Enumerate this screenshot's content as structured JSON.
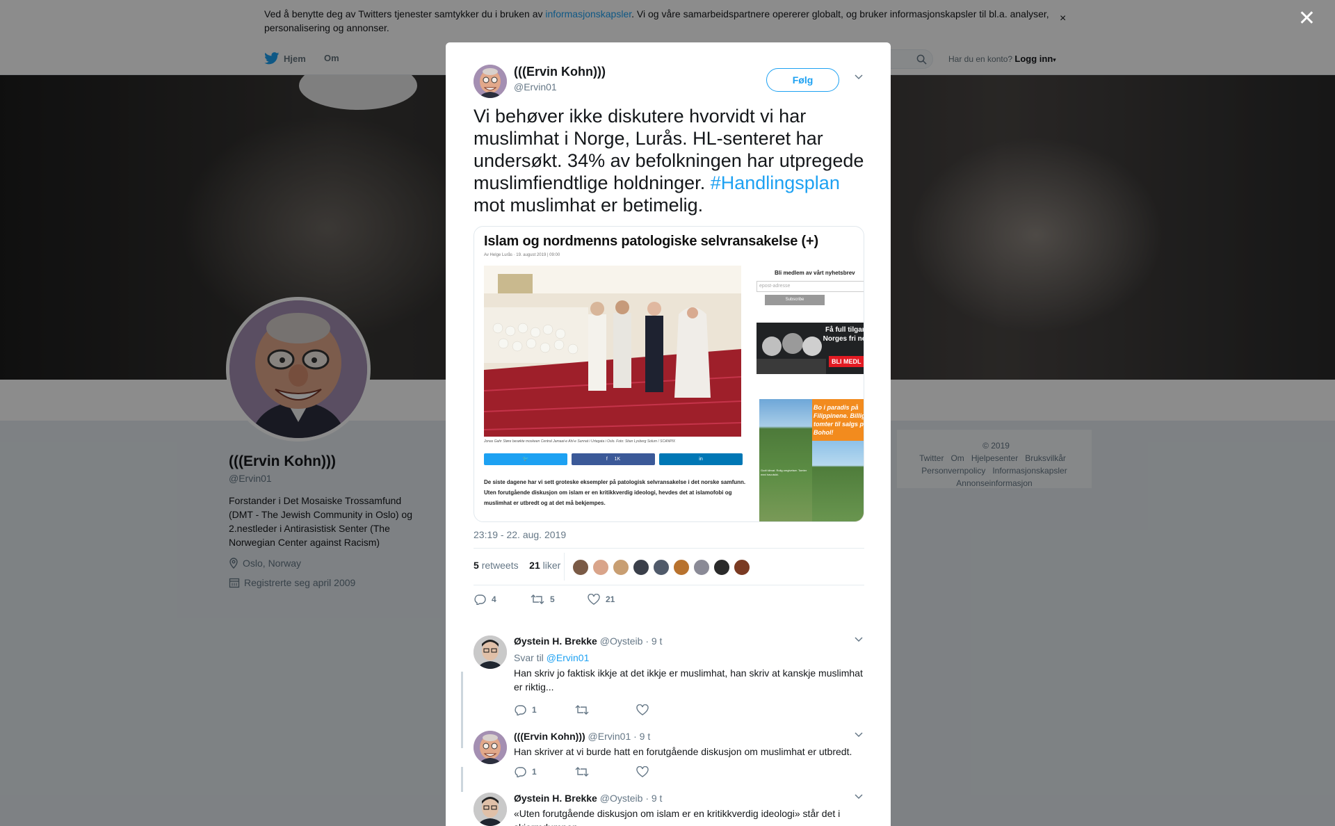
{
  "cookie": {
    "text_before": "Ved å benytte deg av Twitters tjenester samtykker du i bruken av ",
    "link": "informasjonskapsler",
    "text_after": ". Vi og våre samarbeidspartnere opererer globalt, og bruker informasjonskapsler til bl.a. analyser, personalisering og annonser.",
    "close": "×"
  },
  "nav": {
    "home": "Hjem",
    "about": "Om",
    "have_account": "Har du en konto?",
    "login": "Logg inn"
  },
  "profile": {
    "name": "(((Ervin Kohn)))",
    "handle": "@Ervin01",
    "bio": "Forstander i Det Mosaiske Trossamfund (DMT - The Jewish Community in Oslo) og 2.nestleder i Antirasistisk Senter (The Norwegian Center against Racism)",
    "location": "Oslo, Norway",
    "joined": "Registrerte seg april 2009"
  },
  "footer": {
    "row1": [
      "© 2019 Twitter",
      "Om",
      "Hjelpesenter",
      "Bruksvilkår"
    ],
    "row2": [
      "Personvernpolicy",
      "Informasjonskapsler"
    ],
    "row3": [
      "Annonseinformasjon"
    ]
  },
  "overlay_close": "✕",
  "tweet": {
    "name": "(((Ervin Kohn)))",
    "handle": "@Ervin01",
    "follow": "Følg",
    "text": "Vi behøver ikke diskutere hvorvidt vi har muslimhat i Norge, Lurås. HL-senteret har undersøkt. 34% av befolkningen har utpregede muslimfiendtlige holdninger. ",
    "hashtag": "#Handlingsplan",
    "text_end": " mot muslimhat er betimelig.",
    "time": "23:19 - 22. aug. 2019",
    "retweets": "5",
    "retweets_label": "retweets",
    "likes": "21",
    "likes_label": "liker",
    "reply_count": "4",
    "retweet_count": "5",
    "like_count": "21",
    "liker_colors": [
      "#7a5a46",
      "#d9a48a",
      "#c89e72",
      "#3a3f4a",
      "#505a6a",
      "#b8722e",
      "#8a8a96",
      "#2a2a2a",
      "#7a3a22"
    ]
  },
  "card": {
    "headline": "Islam og nordmenns patologiske selvransakelse (+)",
    "byline": "Av Helge Lurås  ·  19. august 2019 | 09:00",
    "caption": "Jonas Gahr Støre besøkte moskeen Central Jamaat-e Ahl-e Sunnat i Urtegata i Oslo. Foto: Stian Lysberg Solum / SCANPIX",
    "share_fb": "1K",
    "body": "De siste dagene har vi sett groteske eksempler på patologisk selvransakelse i det norske samfunn. Uten forutgående diskusjon om islam er en kritikkverdig ideologi, hevdes det at islamofobi og muslimhat er utbredt og at det må bekjempes.",
    "newsletter": "Bli medlem av vårt nyhetsbrev",
    "email_placeholder": "epost-adresse",
    "subscribe": "Subscribe",
    "ad1_text": "Få full tilgang Norges fri nett",
    "ad1_btn": "BLI MEDL",
    "ad2_text": "Bo i paradis på Filippinene. Billige tomter til salgs på Bohol!",
    "ad2_small": "Godt klimat. Rolig omgivelser. Tomter med havutsikt."
  },
  "replies": [
    {
      "name": "Øystein H. Brekke",
      "handle": "@Oysteib",
      "time": "· 9 t",
      "reply_to_label": "Svar til",
      "reply_to": "@Ervin01",
      "text": "Han skriv jo faktisk ikkje at det ikkje er muslimhat, han skriv at kanskje muslimhat er riktig...",
      "replies": "1"
    },
    {
      "name": "(((Ervin Kohn)))",
      "handle": "@Ervin01",
      "time": "· 9 t",
      "text": "Han skriver at vi burde hatt en forutgående diskusjon om muslimhat er utbredt.",
      "replies": "1"
    },
    {
      "name": "Øystein H. Brekke",
      "handle": "@Oysteib",
      "time": "· 9 t",
      "text": "«Uten forutgående diskusjon om islam er en kritikkverdig ideologi» står det i skjermdumpen."
    }
  ]
}
